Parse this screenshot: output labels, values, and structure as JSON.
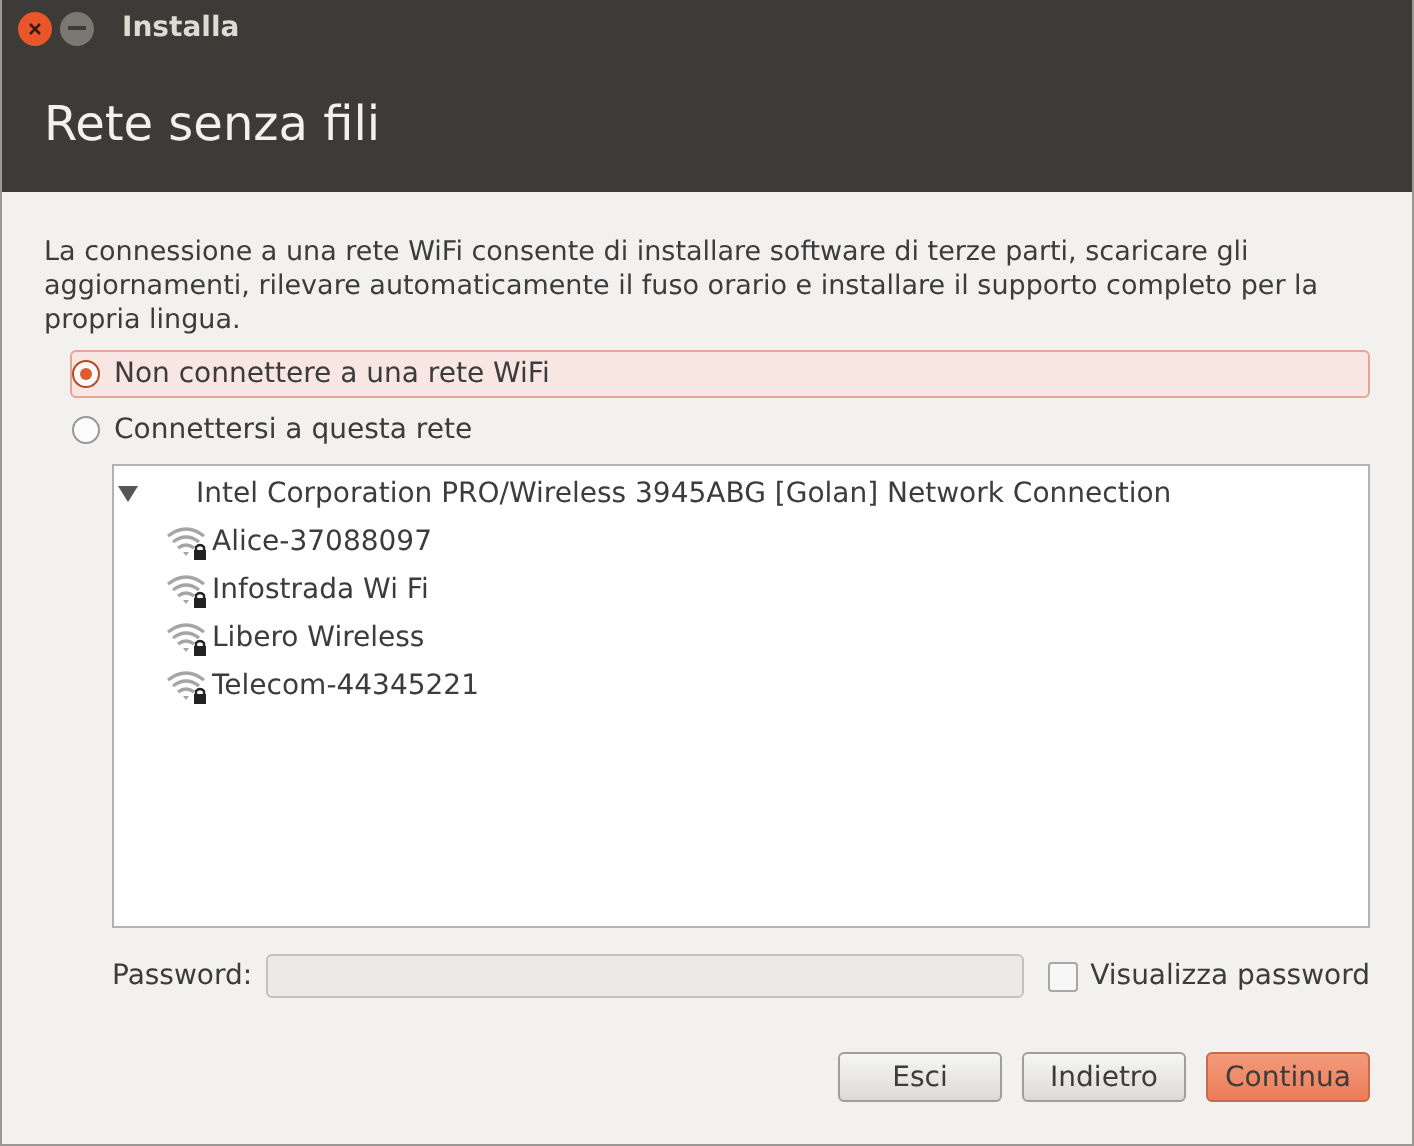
{
  "window": {
    "title": "Installa"
  },
  "page_title": "Rete senza fili",
  "description": "La connessione a una rete WiFi consente di installare software di terze parti, scaricare gli aggiornamenti, rilevare automaticamente il fuso orario e installare il supporto completo per la propria lingua.",
  "options": [
    {
      "label": "Non connettere a una rete WiFi",
      "selected": true
    },
    {
      "label": "Connettersi a questa rete",
      "selected": false
    }
  ],
  "networks": [
    {
      "label": "Intel Corporation PRO/Wireless 3945ABG [Golan] Network Connection",
      "expanded": true,
      "children": [
        {
          "label": "Alice-37088097"
        },
        {
          "label": "Infostrada Wi Fi"
        },
        {
          "label": "Libero Wireless"
        },
        {
          "label": "Telecom-44345221"
        }
      ]
    }
  ],
  "password": {
    "label": "Password:",
    "disabled": true
  },
  "show_password": {
    "label": "Visualizza password",
    "checked": false
  },
  "buttons": [
    {
      "label": "Esci",
      "kind": "normal"
    },
    {
      "label": "Indietro",
      "kind": "normal"
    },
    {
      "label": "Continua",
      "kind": "primary"
    }
  ]
}
